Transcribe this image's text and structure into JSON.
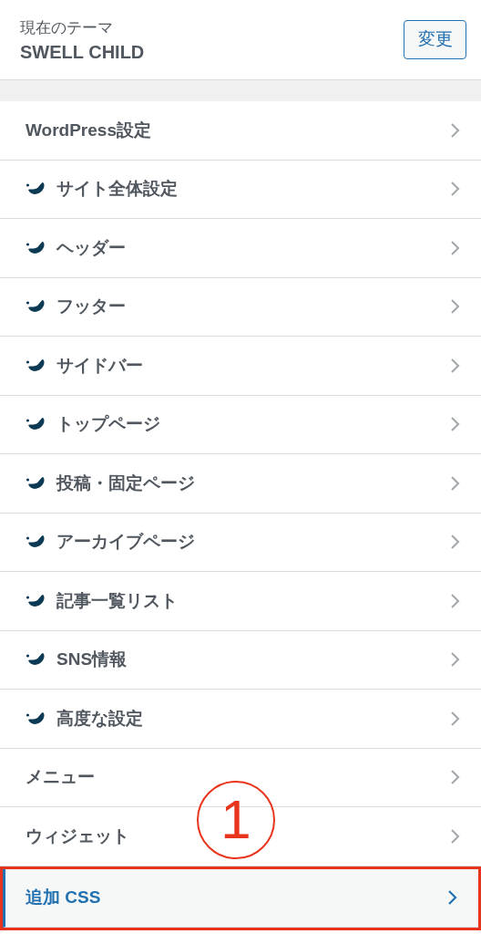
{
  "theme": {
    "caption": "現在のテーマ",
    "name": "SWELL CHILD",
    "button": "変更"
  },
  "items": [
    {
      "label": "WordPress設定",
      "kind": "plain",
      "selected": false,
      "highlighted": false
    },
    {
      "label": "サイト全体設定",
      "kind": "swell",
      "selected": false,
      "highlighted": false
    },
    {
      "label": "ヘッダー",
      "kind": "swell",
      "selected": false,
      "highlighted": false
    },
    {
      "label": "フッター",
      "kind": "swell",
      "selected": false,
      "highlighted": false
    },
    {
      "label": "サイドバー",
      "kind": "swell",
      "selected": false,
      "highlighted": false
    },
    {
      "label": "トップページ",
      "kind": "swell",
      "selected": false,
      "highlighted": false
    },
    {
      "label": "投稿・固定ページ",
      "kind": "swell",
      "selected": false,
      "highlighted": false
    },
    {
      "label": "アーカイブページ",
      "kind": "swell",
      "selected": false,
      "highlighted": false
    },
    {
      "label": "記事一覧リスト",
      "kind": "swell",
      "selected": false,
      "highlighted": false
    },
    {
      "label": "SNS情報",
      "kind": "swell",
      "selected": false,
      "highlighted": false
    },
    {
      "label": "高度な設定",
      "kind": "swell",
      "selected": false,
      "highlighted": false
    },
    {
      "label": "メニュー",
      "kind": "plain",
      "selected": false,
      "highlighted": false
    },
    {
      "label": "ウィジェット",
      "kind": "plain",
      "selected": false,
      "highlighted": false
    },
    {
      "label": "追加 CSS",
      "kind": "plain",
      "selected": true,
      "highlighted": true
    }
  ],
  "annotation": {
    "label": "1"
  }
}
